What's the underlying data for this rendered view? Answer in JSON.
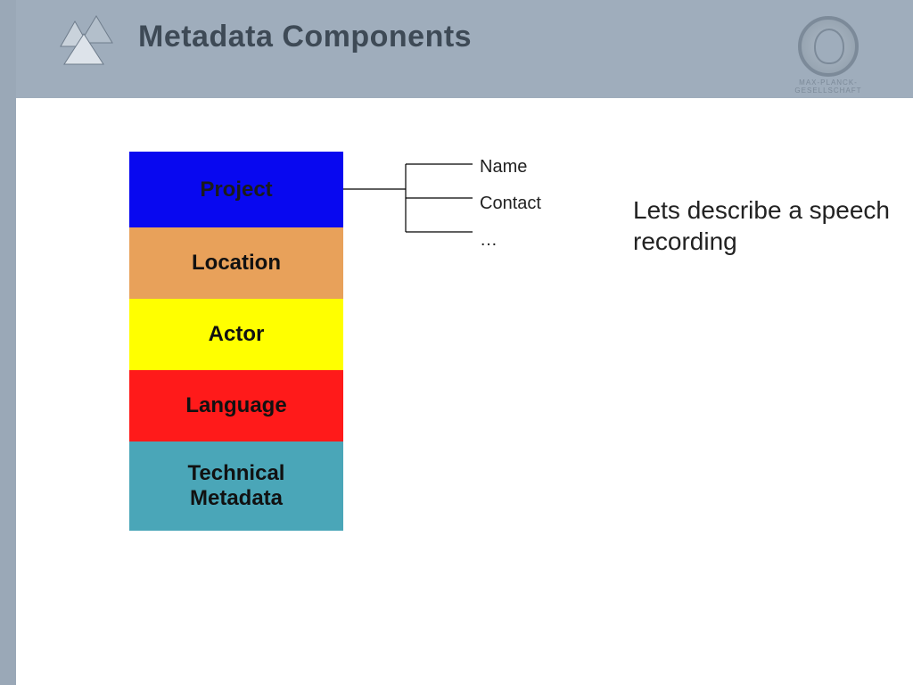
{
  "header": {
    "title": "Metadata Components",
    "emblem_text": "MAX-PLANCK-GESELLSCHAFT"
  },
  "stack": {
    "project": "Project",
    "location": "Location",
    "actor": "Actor",
    "language": "Language",
    "technical": "Technical\nMetadata"
  },
  "callouts": {
    "item1": "Name",
    "item2": "Contact",
    "item3": "…"
  },
  "description": "Lets describe a speech recording"
}
